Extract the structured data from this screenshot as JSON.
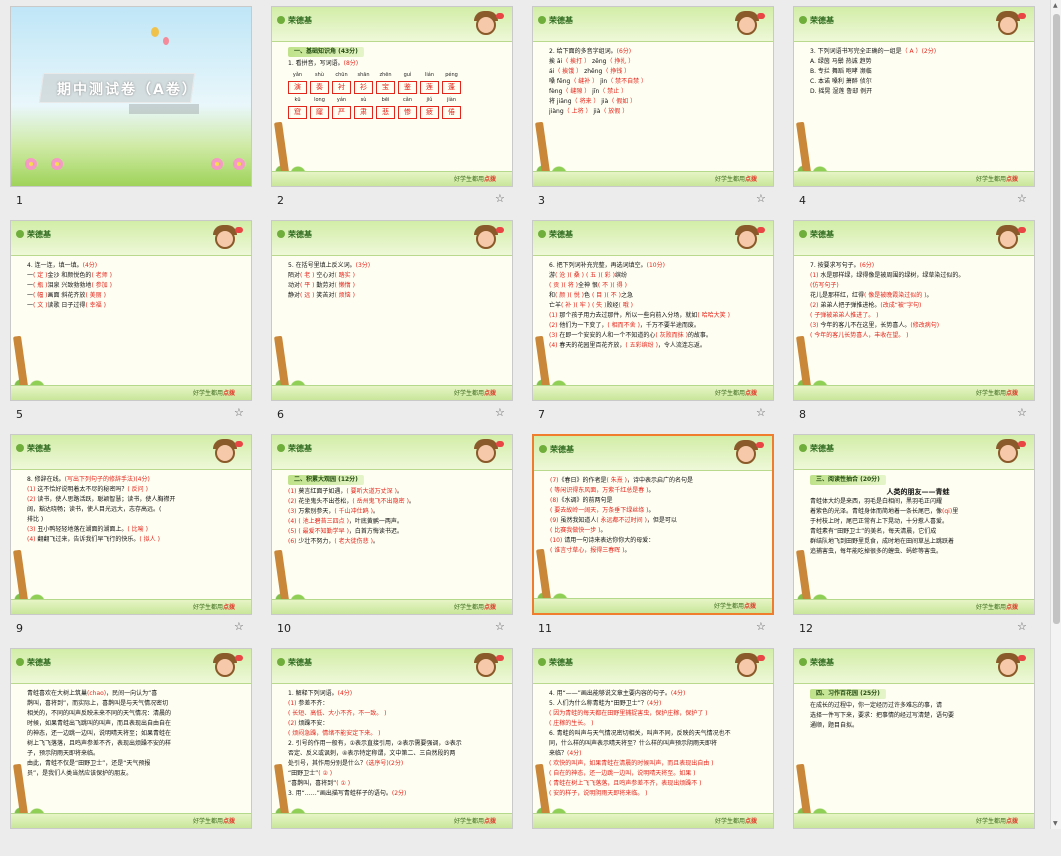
{
  "app": {
    "logo_text": "荣德基",
    "footer_slogan_prefix": "好学生都用",
    "footer_slogan_brand": "点拨",
    "star_icon": "☆"
  },
  "slides": [
    {
      "num": "1",
      "title": "期中测试卷（A卷）",
      "subtitle": ""
    },
    {
      "num": "2",
      "section": "一、基础知识角 (43分)",
      "lines": [
        "1. 看拼音，写词语。(8分)"
      ],
      "pinyin1": [
        "yǎn",
        "shù",
        "chūn",
        "shān",
        "zhēn",
        "guì",
        "lián",
        "péng"
      ],
      "boxes1": [
        "演",
        "奏",
        "衬",
        "衫",
        "宝",
        "鉴",
        "莲",
        "蓬"
      ],
      "pinyin2": [
        "kū",
        "long",
        "yán",
        "sù",
        "bēi",
        "cǎn",
        "jiǔ",
        "jiàn"
      ],
      "boxes2": [
        "窟",
        "窿",
        "严",
        "肃",
        "悲",
        "惨",
        "疲",
        "倦"
      ]
    },
    {
      "num": "3",
      "lines": [
        "2. 给下面的多音字组词。(6分)",
        "挨 āi（ 挨打 ）   zěng（ 挣扎 ）",
        "    ái（ 挨饿 ）   zhēng（ 挣钱 ）",
        "嗓 fēng（ 缝补 ）  jìn（ 禁不自禁 ）",
        "    fèng（ 缝隙 ）  jīn（ 禁止 ）",
        "将 jiāng（ 将来 ）  jià（ 假如 ）",
        "    jiàng（ 上将 ）  jià（ 放假 ）"
      ]
    },
    {
      "num": "4",
      "lines": [
        "3. 下列词语书写完全正确的一组是（ A ）(2分)",
        "A. 绿茵   马鬃   热诚   趋势",
        "B. 专拦   舞蹈   咆哮   濒临",
        "C. 本诺   嗓利   萧醉   侦尔",
        "D. 摇晃   湿莲   鲁邸   例开"
      ]
    },
    {
      "num": "5",
      "lines": [
        "4. 连一连，填一填。(4分)",
        "一( 定 )金沙     和颜悦色的( 老师 )",
        "一( 瓶 )泪泉     兴致勃勃地( 参加 )",
        "一( 幅 )画面     斜花齐放( 美丽 )",
        "一( 文 )读歌     日子过得( 幸福 )"
      ]
    },
    {
      "num": "6",
      "lines": [
        "5. 在括号里填上反义词。(3分)",
        "陌对( 老 )    空心对( 踏实 )",
        "动对( 平 )    勤劳对( 懒惰 )",
        "静对( 远 )    笑苦对( 烦恼 )"
      ]
    },
    {
      "num": "7",
      "lines": [
        "6. 把下列词补充完整，再选词填空。(10分)",
        "游( 沧 )( 桑 )  ( 五 )( 彩 )缤纷",
        "( 贡 )( 将 )全神  恨( 不 )( 得 )",
        "和( 颜 )( 悦 )色  ( 目 )( 不 )之急",
        "亡羊( 补 )( 牢 )  ( 失 )败经( 哦 )",
        "(1) 那个孩子用力去过那件，所以一些向前入分场，就如( 哈哈大笑 )",
        "(2) 他们为一下变了，( 相而不舍 )，千万不要半途而废。",
        "(3) 在即一个安安的人和一个不知道的心( 灰败而抹 )的故事。",
        "(4) 春天的花园里百花齐放，( 五彩缤纷 )，令人流连忘返。"
      ]
    },
    {
      "num": "8",
      "lines": [
        "7. 按要求写句子。(6分)",
        "(1) 水是那样绿，绿得像是被周围的绿树，绿草染过似的。",
        "     (仿写句子)",
        "     花儿是那样红，红得( 像是被晚霞染过似的 )。",
        "(2) 弟弟人把子弹推进枪。(改成“被”字句)",
        "     ( 子弹被弟弟人推进了。 )",
        "(3) 今年的客儿不在这里，长势喜人。(修改病句)",
        "     ( 今年的客儿长势喜人，丰收在望。 )"
      ]
    },
    {
      "num": "9",
      "lines": [
        "8. 修辞在线。(写出下列句子的修辞手法)(4分)",
        "(1) 这不恰好说明着太不尽的秘密吗？( 反问 )",
        "(2) 读书，使人思路活跃，聪颖智慧；读书，使人胸襟开",
        "   阔，豁达晓畅；读书，使人目光远大，志存高远。(",
        "   排比 )",
        "(3) 丑小鸭轻轻地落在湖面的湖面上。( 比喻 )",
        "(4) 翻翻飞过来，告诉我们早飞行的快乐。( 拟人 )"
      ]
    },
    {
      "num": "10",
      "section": "二、积累大观园 (12分)",
      "lines": [
        "(1) 莫言红面子如遇，( 要听大道万丈深 )。",
        "(2) 花坐鬼头不出苍松，( 岳州鬼飞不出隐密 )。",
        "(3) 万紫别参天，( 千山冲仕鸥 )。",
        "(4) ( 池上碧苔三四点 )，叶底黄鹂一两声。",
        "(5) ( 最爱不知勤学早 )，白首方悔读书迟。",
        "(6) 少壮不努力，( 老大徒伤悲 )。"
      ]
    },
    {
      "num": "11",
      "lines": [
        "(7)《春日》的作者是( 朱熹 )，诗中表示启广的名句是",
        "( 等闲识得东风面，万紫千红总是春 )。",
        "(8)《水调》的前两句是",
        "( 要去故岭一阔天，万条垂下绿丝绦 )。",
        "(9) 虽然我知道人( 永远都不过时间 )，但是可以",
        "( 比赛我做快一步 )。",
        "(10) 请用一句诗来表达你你大的母爱：",
        "( 谁言寸草心，报得三春晖 )。"
      ]
    },
    {
      "num": "12",
      "section": "三、阅读性抽合 (20分)",
      "lines": [
        "人类的朋友——青蛙",
        "青蛙体大约是来西，羽毛是白相间，黑羽毛正闪耀",
        "着紫色的光泽。青蛙身体而简地着一条长尾巴，像(qi)里",
        "于村枝上时，尾巴正常有上下晃动，十分惹人喜爱。",
        "青蛙素有“田野卫士”的美名，每天清晨，它们成",
        "群结队地飞到田野里觅食，成时地在田间草丛上跳跃着",
        "追捕害虫，每年能吃掉很多的蝗虫、蚂蚱等害虫。"
      ]
    },
    {
      "num": "",
      "lines": [
        "青蛙喜欢在大树上筑巢(chao)，民间一向认为“喜",
        "鹊叫，喜将到”，而实际上，喜鹊叫是与天气情况密切",
        "相关的，不同的叫声反映未来不同的天气情况：清晨的",
        "时候，如果青蛙出飞跳叫的叫声，而且表现出自由自在",
        "的神态，还一边跳一边叫，说明晴天将至；如果青蛙在",
        "树上飞飞落落，且鸣声参差不齐，表现出烦躁不安的样",
        "子，预示阴雨天即将来临。",
        "由此，青蛙不仅是“田野卫士”，还是“天气预报",
        "员”，是我们人类当然应该保护的朋友。"
      ]
    },
    {
      "num": "",
      "lines": [
        "1. 解释下列词语。(4分)",
        "(1) 参差不齐：",
        "     ( 长短、高低、大小不齐，不一致。 )",
        "(2) 烦躁不安：",
        "     ( 烦闷急躁，情绪不能安定下来。 )",
        "2. 引号的作用一般有，①表示直接引用，②表示需要强调，③表示",
        "   否定、反义或讽刺，④表示特定称谓，文中第二、三自然段的两",
        "   处引号，其作用分别是什么？(选序号)(2分)",
        "   “田野卫士”( ② )",
        "   “喜鹊叫，喜将到”( ① )",
        "3. 用“……”画出描写青蛙样子的语句。(2分)"
      ]
    },
    {
      "num": "",
      "lines": [
        "4. 用“——”画出能够说文章主要内容的句子。(4分)",
        "5. 人们为什么称青蛙为“田野卫士”？(4分)",
        "   ( 因为青蛙的每天都在田野里捕捉害虫，保护庄稼，保护了 )",
        "   ( 庄稼的生长。 )",
        "6. 青蛙的叫声与天气情况密切相关，叫声不同，反映的天气情况也不",
        "   同，什么样的叫声表示晴天将至？什么样的叫声预示阴雨天即将",
        "   来临？(4分)",
        "   ( 欢快的叫声，如果青蛙在清晨的时候叫声，而且表现出自由 )",
        "   ( 自在的神态，还一边跳一边叫，说明晴天将至。如果 )",
        "   ( 青蛙在树上飞飞落落，且鸣声参差不齐，表现出烦躁不 )",
        "   ( 安的样子，说明阴雨天即将来临。 )"
      ]
    },
    {
      "num": "",
      "section": "四、习作百花园 (25分)",
      "lines": [
        "在成长的过程中，你一定经历过许多难忘的事，请",
        "选择一件写下来，要求：把事情的经过写清楚，语句要",
        "通顺，题目自拟。"
      ]
    }
  ]
}
